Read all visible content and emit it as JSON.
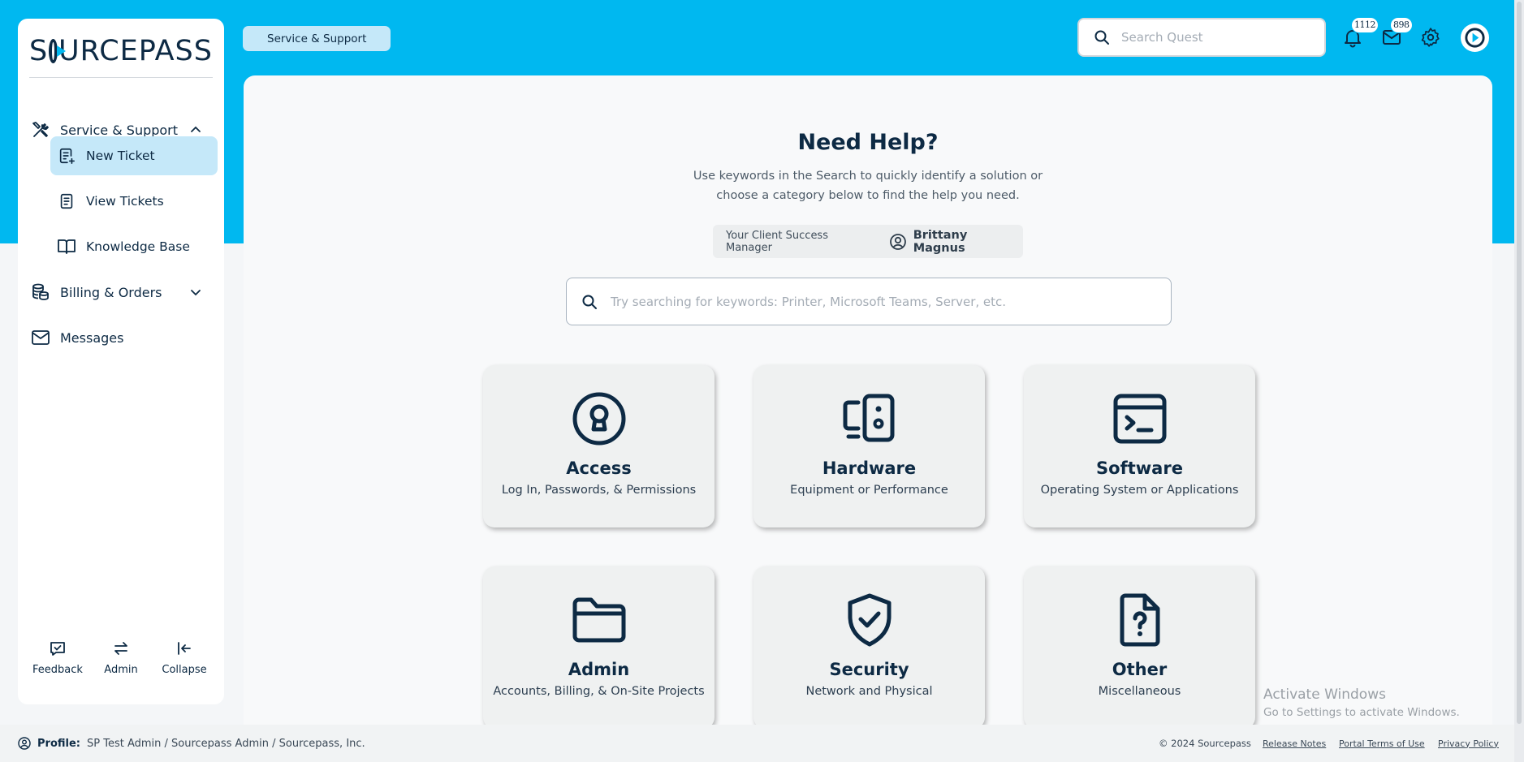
{
  "sidebar": {
    "logo_text": "SOURCEPASS",
    "sections": [
      {
        "label": "Service & Support",
        "icon": "tools-icon",
        "expanded": true
      },
      {
        "label": "Billing & Orders",
        "icon": "coins-icon",
        "expanded": false
      },
      {
        "label": "Messages",
        "icon": "mail-icon"
      }
    ],
    "sub_items": [
      {
        "label": "New Ticket",
        "icon": "new-ticket-icon",
        "active": true
      },
      {
        "label": "View Tickets",
        "icon": "ticket-list-icon"
      },
      {
        "label": "Knowledge Base",
        "icon": "book-icon"
      }
    ],
    "tools": [
      {
        "label": "Feedback",
        "icon": "feedback-icon"
      },
      {
        "label": "Admin",
        "icon": "swap-icon"
      },
      {
        "label": "Collapse",
        "icon": "collapse-icon"
      }
    ]
  },
  "header": {
    "breadcrumb": "Service & Support",
    "search_placeholder": "Search Quest",
    "notifications_count": "1112",
    "messages_count": "898"
  },
  "main": {
    "title": "Need Help?",
    "intro_line1": "Use keywords in the Search to quickly identify a solution or",
    "intro_line2": "choose a category below to find the help you need.",
    "csm_label": "Your Client Success Manager",
    "csm_name": "Brittany Magnus",
    "search_placeholder": "Try searching for keywords: Printer, Microsoft Teams, Server, etc.",
    "categories": [
      {
        "title": "Access",
        "subtitle": "Log In, Passwords, & Permissions",
        "icon": "lock-icon"
      },
      {
        "title": "Hardware",
        "subtitle": "Equipment or Performance",
        "icon": "devices-icon"
      },
      {
        "title": "Software",
        "subtitle": "Operating System or Applications",
        "icon": "terminal-icon"
      },
      {
        "title": "Admin",
        "subtitle": "Accounts, Billing, & On-Site Projects",
        "icon": "folder-icon"
      },
      {
        "title": "Security",
        "subtitle": "Network and Physical",
        "icon": "shield-check-icon"
      },
      {
        "title": "Other",
        "subtitle": "Miscellaneous",
        "icon": "file-question-icon"
      }
    ]
  },
  "watermark": {
    "line1": "Activate Windows",
    "line2": "Go to Settings to activate Windows."
  },
  "footer": {
    "profile_label": "Profile:",
    "profile_value": "SP Test Admin / Sourcepass Admin / Sourcepass, Inc.",
    "copyright": "© 2024 Sourcepass",
    "links": [
      "Release Notes",
      "Portal Terms of Use",
      "Privacy Policy"
    ]
  },
  "colors": {
    "brand": "#00b8f0",
    "navy": "#0d2a44",
    "active_bg": "#c5e8f9"
  }
}
